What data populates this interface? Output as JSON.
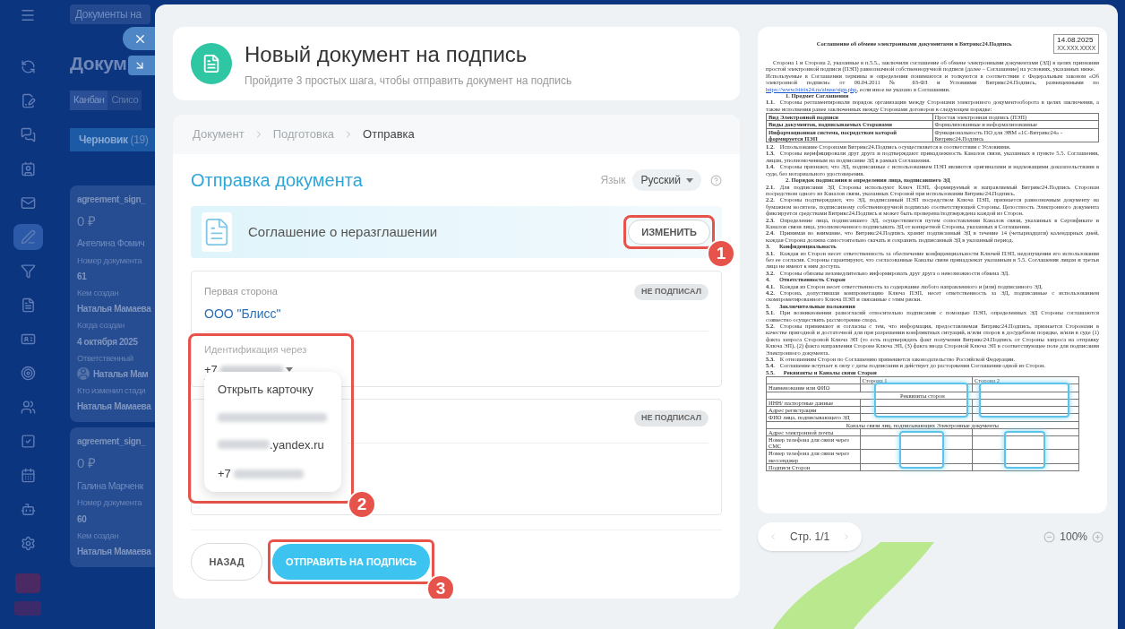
{
  "background": {
    "top_pill": "Документы на",
    "title": "Докум",
    "views": [
      {
        "label": "Канбан",
        "selected": true
      },
      {
        "label": "Списо",
        "selected": false
      }
    ],
    "column": {
      "name": "Черновик",
      "count": "(19)"
    },
    "sidebar_items": [
      {
        "selected": false
      },
      {
        "selected": false
      },
      {
        "selected": false
      },
      {
        "selected": false
      },
      {
        "selected": false
      },
      {
        "selected": true
      },
      {
        "selected": false
      },
      {
        "selected": false
      },
      {
        "selected": false
      },
      {
        "selected": false
      },
      {
        "selected": false
      },
      {
        "selected": false
      },
      {
        "selected": false
      },
      {
        "selected": false
      },
      {
        "selected": false
      }
    ],
    "cards": [
      {
        "title": "agreement_sign_",
        "amount": "0 ₽",
        "client": "Ангелина Фомич",
        "fields": [
          {
            "label": "Номер документа",
            "value": "61",
            "kind": "text"
          },
          {
            "label": "Кем создан",
            "value": "Наталья Мамаева",
            "kind": "text"
          },
          {
            "label": "Когда создан",
            "value": "4 октября 2025",
            "kind": "text"
          },
          {
            "label": "Ответственный",
            "value": "Наталья Мам",
            "kind": "user"
          },
          {
            "label": "Кто изменил стади",
            "value": "Наталья Мамаева",
            "kind": "text"
          }
        ]
      },
      {
        "title": "agreement_sign_",
        "amount": "0 ₽",
        "client": "Галина Марченк",
        "fields": [
          {
            "label": "Номер документа",
            "value": "60",
            "kind": "text"
          },
          {
            "label": "Кем создан",
            "value": "Наталья Мамаева",
            "kind": "text"
          }
        ]
      }
    ]
  },
  "header": {
    "title": "Новый документ на подпись",
    "subtitle": "Пройдите 3 простых шага, чтобы отправить документ на подпись"
  },
  "steps": [
    {
      "label": "Документ",
      "selected": false
    },
    {
      "label": "Подготовка",
      "selected": false
    },
    {
      "label": "Отправка",
      "selected": true
    }
  ],
  "section_title": "Отправка документа",
  "language": {
    "label": "Язык",
    "value": "Русский"
  },
  "document": {
    "name": "Соглашение о неразглашении",
    "button": "ИЗМЕНИТЬ",
    "callout": "1"
  },
  "parties": [
    {
      "label": "Первая сторона",
      "status": "НЕ ПОДПИСАЛ",
      "name": "ООО \"Блисс\"",
      "identification": {
        "label": "Идентификация через",
        "prefix": "+7"
      }
    },
    {
      "status": "НЕ ПОДПИСАЛ"
    }
  ],
  "dropdown": {
    "items": [
      {
        "kind": "text",
        "text": "Открыть карточку"
      },
      {
        "kind": "hidden"
      },
      {
        "kind": "partial",
        "text": ".yandex.ru"
      },
      {
        "kind": "phone",
        "text": "+7"
      }
    ],
    "callout": "2"
  },
  "footer": {
    "back": "НАЗАД",
    "send": "ОТПРАВИТЬ НА ПОДПИСЬ",
    "callout": "3"
  },
  "preview": {
    "title": "Соглашение об обмене электронными документами в Битрикс24.Подпись",
    "date": "14.08.2025",
    "number": "XX.XXX.XXXX",
    "blocks": [
      {
        "kind": "para",
        "text": "Сторона 1 и Сторона 2, указанные в п.5.5., заключили соглашение об обмене электронными документами (ЭД) в целях признания простой электронной подписи (ПЭП) равнозначной собственноручной подписи (далее – Соглашение) на условиях, указанных ниже."
      },
      {
        "kind": "para_link",
        "before": "Используемые в Соглашении термины и определения понимаются и толкуются в соответствии с Федеральным законом «Об электронной подписи» от 06.04.2011 № 63-ФЗ и Условиями Битрикс24.Подпись, размещенными по ",
        "link": "https://www.bitrix24.ru/abuse/sign.php",
        "after": ", если иное не указано в Соглашении."
      },
      {
        "kind": "heading",
        "num": "1.",
        "text": "Предмет Соглашения"
      },
      {
        "kind": "clause",
        "num": "1.1.",
        "text": "Стороны регламентировали порядок организации между Сторонами электронного документооборота в целях заключения, а также исполнения ранее заключенных между Сторонами договоров в следующем порядке:"
      },
      {
        "kind": "table",
        "rows": [
          [
            "Вид Электронной подписи",
            "Простая электронная подпись (ПЭП)"
          ],
          [
            "Виды документов, подписываемых Сторонами",
            "Формализованные и неформализованные"
          ],
          [
            "Информационная система, посредством которой формируется ПЭП",
            "Функциональность ПО для ЭВМ «1С-Битрикс24» - Битрикс24.Подпись"
          ]
        ]
      },
      {
        "kind": "clause",
        "num": "1.2.",
        "text": "Использование Сторонами Битрикс24.Подпись осуществляется в соответствии с Условиями."
      },
      {
        "kind": "clause",
        "num": "1.3.",
        "text": "Стороны верифицировали друг друга и подтверждают принадлежность Каналов связи, указанных в пункте 5.5. Соглашения, лицам, уполномоченным на подписание ЭД в рамках Соглашения."
      },
      {
        "kind": "clause",
        "num": "1.4.",
        "text": "Стороны признают, что ЭД, подписанные с использованием ПЭП являются оригиналами и надлежащими доказательствами в суде, без нотариального удостоверения."
      },
      {
        "kind": "heading",
        "num": "2.",
        "text": "Порядок подписания и определения лица, подписавшего ЭД"
      },
      {
        "kind": "clause",
        "num": "2.1.",
        "text": "Для подписания ЭД Стороны используют Ключ ПЭП, формируемый и направляемый Битрикс24.Подпись Сторонам посредством одного из Каналов связи, указанных Стороной при использовании Битрикс24.Подпись."
      },
      {
        "kind": "clause",
        "num": "2.2.",
        "text": "Стороны подтверждают, что ЭД, подписанный ПЭП посредством Ключа ПЭП, признается равнозначным документу на бумажном носителе, подписанному собственноручной подписью соответствующей Стороны. Целостность Электронного документа фиксируется средствами Битрикс24.Подпись и может быть проверена/подтверждена каждой из Сторон."
      },
      {
        "kind": "clause",
        "num": "2.3.",
        "text": "Определение лица, подписавшего ЭД, осуществляется путем сопоставления Каналов связи, указанных в Сертификате и Каналов связи лица, уполномоченного подписывать ЭД от конкретной Стороны, указанных в Соглашении."
      },
      {
        "kind": "clause",
        "num": "2.4.",
        "text": "Принимая во внимание, что Битрикс24.Подпись хранит подписанный ЭД в течение 14 (четырнадцати) календарных дней, каждая Сторона должна самостоятельно скачать и сохранить подписанный ЭД в указанный период."
      },
      {
        "kind": "section",
        "num": "3.",
        "text": "Конфиденциальность"
      },
      {
        "kind": "clause",
        "num": "3.1.",
        "text": "Каждая из Сторон несет ответственность за обеспечение конфиденциальности Ключей ПЭП, недопущения его использования без ее согласия. Стороны гарантируют, что согласованные Каналы связи принадлежат указанным в 5.5. Соглашения лицам и третьи лица не имеют к ним доступа."
      },
      {
        "kind": "clause",
        "num": "3.2.",
        "text": "Стороны обязаны незамедлительно информировать друг друга о невозможности обмена ЭД."
      },
      {
        "kind": "section",
        "num": "4.",
        "text": "Ответственность Сторон"
      },
      {
        "kind": "clause",
        "num": "4.1.",
        "text": "Каждая из Сторон несет ответственность за содержание любого направленного и (или) подписанного ЭД."
      },
      {
        "kind": "clause",
        "num": "4.2.",
        "text": "Сторона, допустившая компрометацию Ключа ПЭП, несет ответственность за ЭД, подписанные с использованием скомпрометированного Ключа ПЭП и связанные с этим риски."
      },
      {
        "kind": "section",
        "num": "5.",
        "text": "Заключительные положения"
      },
      {
        "kind": "clause",
        "num": "5.1.",
        "text": "При возникновении разногласий относительно подписания с помощью ПЭП, определенных ЭД Стороны соглашаются совместно осуществить рассмотрение спора."
      },
      {
        "kind": "clause",
        "num": "5.2.",
        "text": "Стороны принимают и согласны с тем, что информация, предоставляемая Битрикс24.Подпись, признается Сторонами в качестве пригодной и достаточной для при разрешении конфликтных ситуаций, и/или споров в досудебном порядке, и/или в суде (1) факта запроса Стороной Ключа ЭП (то есть подтверждать факт получения Битрикс24.Подпись от Стороны запроса на отправку Ключа ЭП), (2) факта направления Стороне Ключа ЭП, (3) факта ввода Стороной Ключа ЭП в соответствующее поле для подписания Электронного документа."
      },
      {
        "kind": "clause",
        "num": "5.3.",
        "text": "К отношениям Сторон по Соглашению применяется законодательство Российской Федерации."
      },
      {
        "kind": "clause",
        "num": "5.4.",
        "text": "Соглашение вступает в силу с даты подписания и действует до расторжения Соглашения одной из Сторон."
      },
      {
        "kind": "section",
        "num": "5.5.",
        "text": "Реквизиты и Каналы связи Сторон"
      },
      {
        "kind": "requisites",
        "columns": [
          "Сторона 1",
          "Сторона 2"
        ],
        "rows": [
          {
            "kind": "row",
            "text": "Наименование или ФИО"
          },
          {
            "kind": "span",
            "text": "Реквизиты сторон"
          },
          {
            "kind": "row",
            "text": "ИНН/ паспортные данные"
          },
          {
            "kind": "row",
            "text": "Адрес регистрации"
          },
          {
            "kind": "row",
            "text": "ФИО лица, подписывающего ЭД"
          },
          {
            "kind": "span",
            "text": "Каналы связи лиц, подписывающих Электронные документы"
          },
          {
            "kind": "row",
            "text": "Адрес электронной почты"
          },
          {
            "kind": "row",
            "text": "Номер телефона для связи через СМС"
          },
          {
            "kind": "row",
            "text": "Номер телефона для связи через мессенджер"
          },
          {
            "kind": "row",
            "text": "Подписи Сторон"
          }
        ]
      }
    ]
  },
  "pager": {
    "label": "Стр. 1/1"
  },
  "zoom": {
    "value": "100%"
  }
}
